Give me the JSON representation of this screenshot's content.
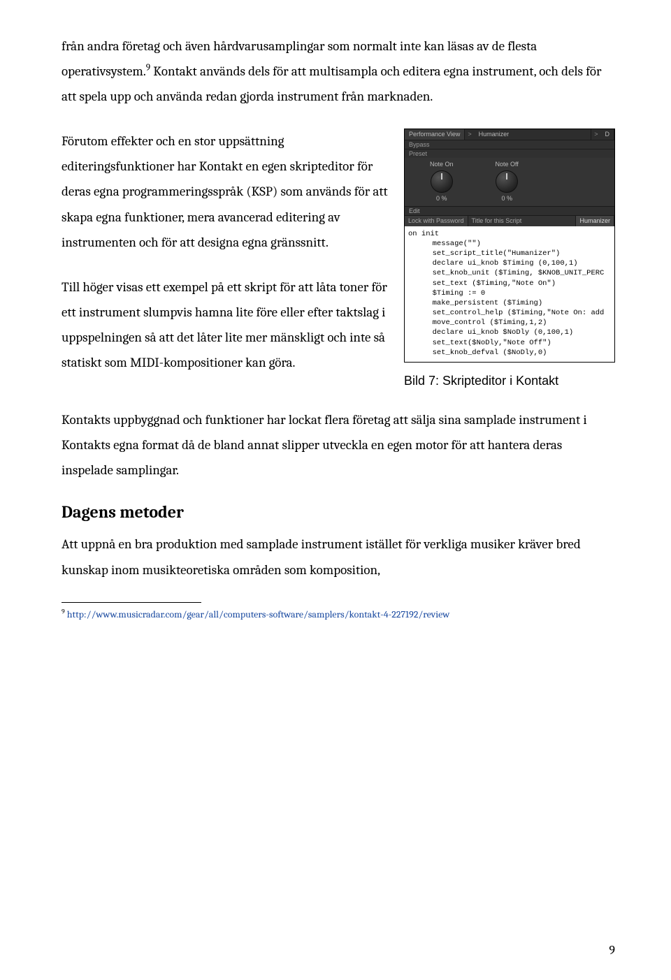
{
  "paragraphs": {
    "p1": "från andra företag och även hårdvarusamplingar som normalt inte kan läsas av de flesta operativsystem.",
    "p1_sup": "9",
    "p1b": " Kontakt används dels för att multisampla och editera egna instrument, och dels för att spela upp och använda redan gjorda instrument från marknaden.",
    "p2": "Förutom effekter och en stor uppsättning editeringsfunktioner har Kontakt en egen skripteditor för deras egna programmeringsspråk (KSP) som används för att skapa egna funktioner, mera avancerad editering av instrumenten och för att designa egna gränssnitt.",
    "p3": "Till höger visas ett exempel på ett skript för att låta toner för ett instrument slumpvis hamna lite före eller efter taktslag i uppspelningen så att det låter lite mer mänskligt och inte så statiskt som MIDI-kompositioner kan göra.",
    "p4": " Kontakts uppbyggnad och funktioner har lockat flera företag att sälja sina samplade instrument i Kontakts egna format då de bland annat slipper utveckla en egen motor för att hantera deras inspelade samplingar.",
    "p5": "Att uppnå en bra produktion med samplade instrument istället för verkliga musiker kräver bred kunskap inom musikteoretiska områden som komposition,"
  },
  "heading": "Dagens metoder",
  "caption": "Bild 7: Skripteditor i Kontakt",
  "footnote": {
    "num": "9",
    "url": "http://www.musicradar.com/gear/all/computers-software/samplers/kontakt-4-227192/review"
  },
  "page_number": "9",
  "scriptshot": {
    "tabs": {
      "perf": "Performance View",
      "chev": ">",
      "hum": "Humanizer",
      "chev2": ">",
      "d": "D"
    },
    "rows": {
      "bypass": "Bypass",
      "preset": "Preset"
    },
    "knobs": {
      "noteon_label": "Note On",
      "noteon_val": "0    %",
      "noteoff_label": "Note Off",
      "noteoff_val": "0    %"
    },
    "edit": "Edit",
    "meta": {
      "lock": "Lock with Password",
      "title": "Title for this Script",
      "name": "Humanizer"
    },
    "code_lines": [
      "on init",
      "  message(\"\")",
      "  set_script_title(\"Humanizer\")",
      "",
      "  declare ui_knob $Timing (0,100,1)",
      "  set_knob_unit ($Timing, $KNOB_UNIT_PERC",
      "  set_text ($Timing,\"Note On\")",
      "  $Timing := 0",
      "  make_persistent ($Timing)",
      "  set_control_help ($Timing,\"Note On: add",
      "  move_control ($Timing,1,2)",
      "",
      "  declare ui_knob $NoDly (0,100,1)",
      "  set_text($NoDly,\"Note Off\")",
      "  set_knob_defval ($NoDly,0)"
    ]
  }
}
